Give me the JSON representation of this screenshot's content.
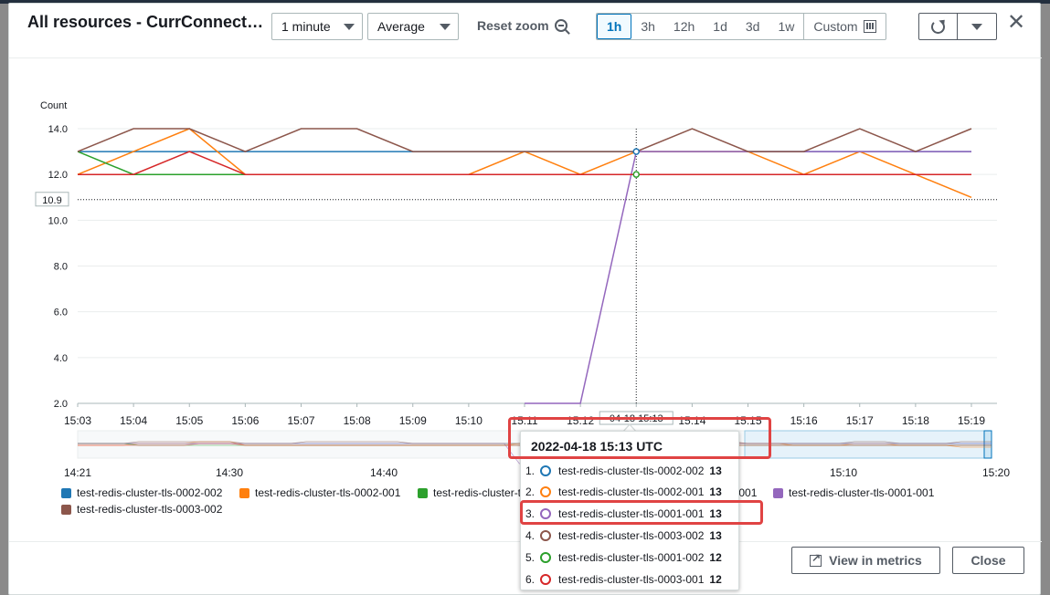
{
  "header": {
    "title": "All resources - CurrConnections",
    "period": "1 minute",
    "statistic": "Average",
    "reset_zoom": "Reset zoom",
    "ranges": [
      "1h",
      "3h",
      "12h",
      "1d",
      "3d",
      "1w"
    ],
    "active_range": "1h",
    "custom": "Custom"
  },
  "colors": {
    "test-redis-cluster-tls-0002-002": "#1f77b4",
    "test-redis-cluster-tls-0002-001": "#ff7f0e",
    "test-redis-cluster-tls-0001-002": "#2ca02c",
    "test-redis-cluster-tls-0001-001": "#9467bd",
    "test-redis-cluster-tls-0003-002": "#8c564b",
    "test-redis-cluster-tls-0003-001": "#d62728"
  },
  "chart_data": {
    "type": "line",
    "ylabel": "Count",
    "yticks": [
      "14.0",
      "12.0",
      "10.0",
      "8.0",
      "6.0",
      "4.0",
      "2.0"
    ],
    "ylim": [
      2,
      14
    ],
    "threshold": {
      "value": 10.9,
      "label": "10.9"
    },
    "x": [
      "15:03",
      "15:04",
      "15:05",
      "15:06",
      "15:07",
      "15:08",
      "15:09",
      "15:10",
      "15:11",
      "15:12",
      "15:13",
      "15:14",
      "15:15",
      "15:16",
      "15:17",
      "15:18",
      "15:19"
    ],
    "crosshair": {
      "x": "15:13",
      "label": "04-18 15:13"
    },
    "series": [
      {
        "name": "test-redis-cluster-tls-0002-002",
        "values": [
          13,
          13,
          13,
          13,
          13,
          13,
          13,
          13,
          13,
          13,
          13,
          13,
          13,
          13,
          13,
          13,
          13
        ]
      },
      {
        "name": "test-redis-cluster-tls-0002-001",
        "values": [
          12,
          13,
          14,
          12,
          12,
          12,
          12,
          12,
          13,
          12,
          13,
          13,
          13,
          12,
          13,
          12,
          11
        ]
      },
      {
        "name": "test-redis-cluster-tls-0001-002",
        "values": [
          13,
          12,
          12,
          12,
          12,
          12,
          12,
          12,
          12,
          12,
          12,
          12,
          12,
          12,
          12,
          12,
          12
        ]
      },
      {
        "name": "test-redis-cluster-tls-0001-001",
        "values": [
          null,
          null,
          null,
          null,
          null,
          null,
          null,
          null,
          2,
          2,
          13,
          13,
          13,
          13,
          13,
          13,
          13
        ]
      },
      {
        "name": "test-redis-cluster-tls-0003-002",
        "values": [
          13,
          14,
          14,
          13,
          14,
          14,
          13,
          13,
          13,
          13,
          13,
          14,
          13,
          13,
          14,
          13,
          14
        ]
      },
      {
        "name": "test-redis-cluster-tls-0003-001",
        "values": [
          12,
          12,
          13,
          12,
          12,
          12,
          12,
          12,
          12,
          12,
          12,
          12,
          12,
          12,
          12,
          12,
          12
        ]
      }
    ],
    "overview": {
      "ticks": [
        "14:21",
        "14:30",
        "14:40",
        "15:10",
        "15:20"
      ]
    }
  },
  "tooltip": {
    "title": "2022-04-18 15:13 UTC",
    "rows": [
      {
        "idx": "1.",
        "name": "test-redis-cluster-tls-0002-002",
        "value": "13",
        "color": "#1f77b4"
      },
      {
        "idx": "2.",
        "name": "test-redis-cluster-tls-0002-001",
        "value": "13",
        "color": "#ff7f0e"
      },
      {
        "idx": "3.",
        "name": "test-redis-cluster-tls-0001-001",
        "value": "13",
        "color": "#9467bd"
      },
      {
        "idx": "4.",
        "name": "test-redis-cluster-tls-0003-002",
        "value": "13",
        "color": "#8c564b"
      },
      {
        "idx": "5.",
        "name": "test-redis-cluster-tls-0001-002",
        "value": "12",
        "color": "#2ca02c"
      },
      {
        "idx": "6.",
        "name": "test-redis-cluster-tls-0003-001",
        "value": "12",
        "color": "#d62728"
      }
    ]
  },
  "legend": [
    {
      "name": "test-redis-cluster-tls-0002-002",
      "color": "#1f77b4"
    },
    {
      "name": "test-redis-cluster-tls-0002-001",
      "color": "#ff7f0e"
    },
    {
      "name": "test-redis-cluster-tls-0001-002",
      "color": "#2ca02c"
    },
    {
      "name": "test-redis-cluster-tls-0001-001",
      "color": "#9467bd"
    },
    {
      "name": "test-redis-cluster-tls-0001-001",
      "color": "#9467bd"
    },
    {
      "name": "test-redis-cluster-tls-0003-002",
      "color": "#8c564b"
    }
  ],
  "footer": {
    "view_in_metrics": "View in metrics",
    "close": "Close"
  }
}
